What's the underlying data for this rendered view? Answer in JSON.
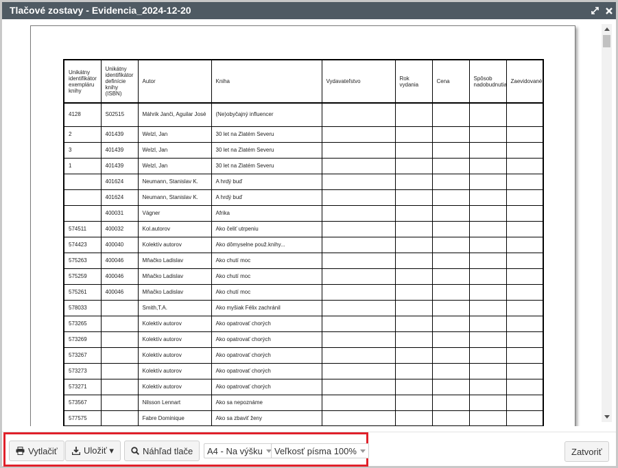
{
  "window": {
    "title": "Tlačové zostavy - Evidencia_2024-12-20"
  },
  "table": {
    "headers": [
      "Unikátny identifikátor exempláru knihy",
      "Unikátny identifikátor definície knihy (ISBN)",
      "Autor",
      "Kniha",
      "Vydavateľstvo",
      "Rok vydania",
      "Cena",
      "Spôsob nadobudnutia",
      "Zaevidované"
    ],
    "rows": [
      [
        "4128",
        "S02515",
        "Máhrik Janči, Aguilar José",
        "(Ne)obyčajný influencer"
      ],
      [
        "2",
        "401439",
        "Welzl, Jan",
        "30 let na Zlatém Severu"
      ],
      [
        "3",
        "401439",
        "Welzl, Jan",
        "30 let na Zlatém Severu"
      ],
      [
        "1",
        "401439",
        "Welzl, Jan",
        "30 let na Zlatém Severu"
      ],
      [
        "",
        "401624",
        "Neumann, Stanislav K.",
        "A hrdý buď"
      ],
      [
        "",
        "401624",
        "Neumann, Stanislav K.",
        "A hrdý buď"
      ],
      [
        "",
        "400031",
        "Vágner",
        "Afrika"
      ],
      [
        "574511",
        "400032",
        "Kol.autorov",
        "Ako čeliť utrpeniu"
      ],
      [
        "574423",
        "400040",
        "Kolektív autorov",
        "Ako dômyselne použ.knihy..."
      ],
      [
        "575263",
        "400046",
        "Mňačko Ladislav",
        "Ako chutí moc"
      ],
      [
        "575259",
        "400046",
        "Mňačko Ladislav",
        "Ako chutí moc"
      ],
      [
        "575261",
        "400046",
        "Mňačko Ladislav",
        "Ako chutí moc"
      ],
      [
        "578033",
        "",
        "Smith,T.A.",
        "Ako myšiak Félix zachránil"
      ],
      [
        "573265",
        "",
        "Kolektív autorov",
        "Ako opatrovať chorých"
      ],
      [
        "573269",
        "",
        "Kolektív autorov",
        "Ako opatrovať chorých"
      ],
      [
        "573267",
        "",
        "Kolektív autorov",
        "Ako opatrovať chorých"
      ],
      [
        "573273",
        "",
        "Kolektív autorov",
        "Ako opatrovať chorých"
      ],
      [
        "573271",
        "",
        "Kolektív autorov",
        "Ako opatrovať chorých"
      ],
      [
        "573567",
        "",
        "Nilsson Lennart",
        "Ako sa nepoznáme"
      ],
      [
        "577575",
        "",
        "Fabre Dominique",
        "Ako sa zbaviť ženy"
      ]
    ]
  },
  "footer": {
    "print_label": "Vytlačiť",
    "save_label": "Uložiť ▾",
    "preview_label": "Náhľad tlače",
    "page_format": "A4 - Na výšku",
    "font_size": "Veľkosť písma 100%",
    "close_label": "Zatvoriť"
  },
  "colors": {
    "titlebar": "#4f5a63",
    "highlight": "#e0202a"
  },
  "icons": {
    "maximize": "maximize-icon",
    "close": "close-icon",
    "print": "printer-icon",
    "save": "download-icon",
    "preview": "search-icon"
  }
}
